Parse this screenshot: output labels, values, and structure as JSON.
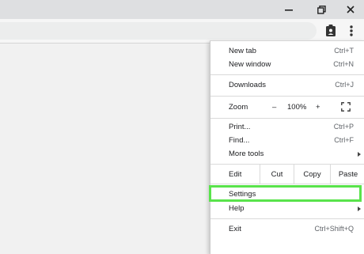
{
  "window": {
    "controls": [
      "minimize-icon",
      "restore-icon",
      "close-icon"
    ]
  },
  "toolbar": {
    "icons": [
      "account-badge-icon",
      "more-vert-icon"
    ]
  },
  "menu": {
    "new_tab": {
      "label": "New tab",
      "shortcut": "Ctrl+T"
    },
    "new_window": {
      "label": "New window",
      "shortcut": "Ctrl+N"
    },
    "downloads": {
      "label": "Downloads",
      "shortcut": "Ctrl+J"
    },
    "zoom": {
      "label": "Zoom",
      "minus": "–",
      "value": "100%",
      "plus": "+"
    },
    "print": {
      "label": "Print...",
      "shortcut": "Ctrl+P"
    },
    "find": {
      "label": "Find...",
      "shortcut": "Ctrl+F"
    },
    "more_tools": {
      "label": "More tools"
    },
    "edit": {
      "label": "Edit",
      "cut": "Cut",
      "copy": "Copy",
      "paste": "Paste"
    },
    "settings": {
      "label": "Settings"
    },
    "help": {
      "label": "Help"
    },
    "exit": {
      "label": "Exit",
      "shortcut": "Ctrl+Shift+Q"
    }
  },
  "highlight_color": "#59e34b"
}
